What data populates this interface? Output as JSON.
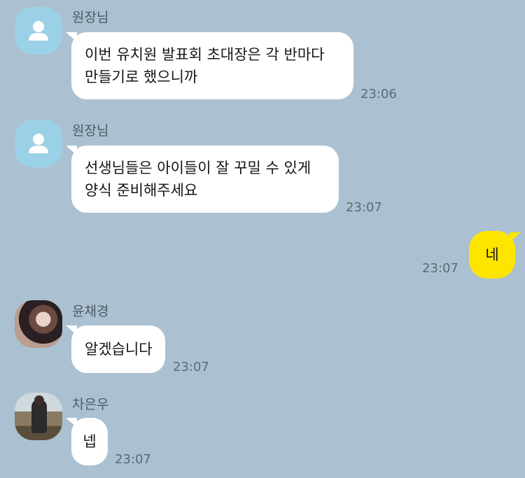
{
  "messages": [
    {
      "sender": "원장님",
      "lines": [
        "이번 유치원 발표회 초대장은 각 반마다",
        "만들기로 했으니까"
      ],
      "time": "23:06"
    },
    {
      "sender": "원장님",
      "lines": [
        "선생님들은 아이들이 잘 꾸밀 수 있게",
        "양식 준비해주세요"
      ],
      "time": "23:07"
    },
    {
      "sender": "me",
      "lines": [
        "네"
      ],
      "time": "23:07"
    },
    {
      "sender": "윤채경",
      "lines": [
        "알겠습니다"
      ],
      "time": "23:07"
    },
    {
      "sender": "차은우",
      "lines": [
        "넵"
      ],
      "time": "23:07"
    }
  ],
  "colors": {
    "background": "#abc1d1",
    "bubble_other": "#ffffff",
    "bubble_mine": "#fee500",
    "default_avatar": "#9bd1e6"
  },
  "icons": {
    "default_avatar": "person-icon"
  }
}
